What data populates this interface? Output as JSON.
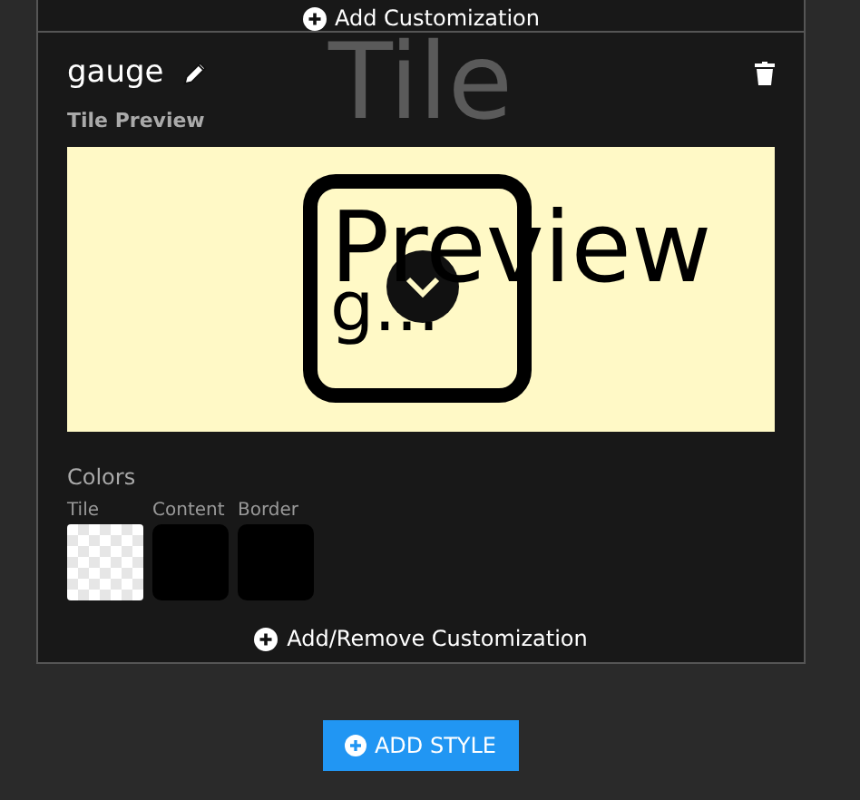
{
  "top_bar": {
    "add_customization": "Add Customization"
  },
  "style": {
    "name": "gauge",
    "overlay_title": "Tile",
    "preview_label": "Tile Preview",
    "preview": {
      "text": "Preview",
      "secondary_text": "g..."
    },
    "colors_label": "Colors",
    "swatches": [
      {
        "label": "Tile",
        "kind": "transparent"
      },
      {
        "label": "Content",
        "kind": "solid",
        "color": "#000000"
      },
      {
        "label": "Border",
        "kind": "solid",
        "color": "#000000"
      }
    ],
    "add_remove": "Add/Remove Customization"
  },
  "add_style": "ADD STYLE"
}
